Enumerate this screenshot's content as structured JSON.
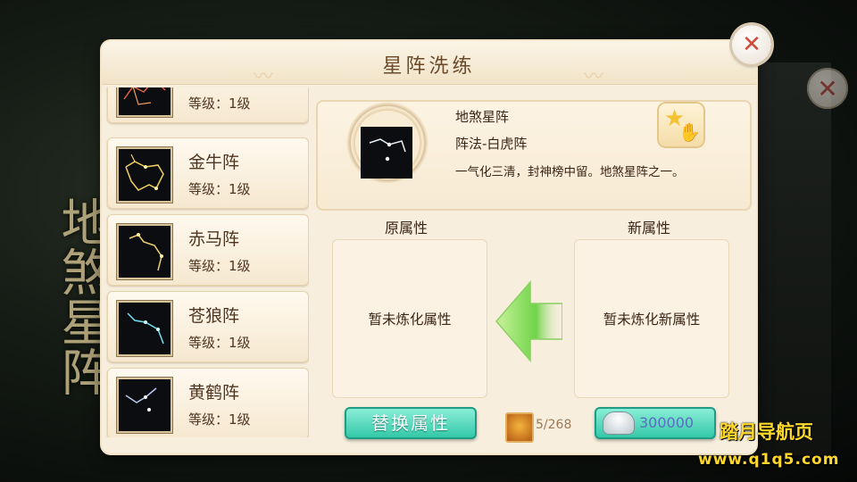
{
  "background": {
    "vertical_title": "地煞星阵"
  },
  "dialog": {
    "title": "星阵洗练",
    "close_icon": "close-x-icon"
  },
  "formation_list": [
    {
      "name": "",
      "level": "等级：1级",
      "icon": "constellation-icon"
    },
    {
      "name": "金牛阵",
      "level": "等级：1级",
      "icon": "golden-ox-constellation-icon"
    },
    {
      "name": "赤马阵",
      "level": "等级：1级",
      "icon": "red-horse-constellation-icon"
    },
    {
      "name": "苍狼阵",
      "level": "等级：1级",
      "icon": "grey-wolf-constellation-icon"
    },
    {
      "name": "黄鹤阵",
      "level": "等级：1级",
      "icon": "yellow-crane-constellation-icon"
    }
  ],
  "detail": {
    "name": "地煞星阵",
    "method": "阵法-白虎阵",
    "description": "一气化三清，封神榜中留。地煞星阵之一。",
    "icon": "white-tiger-constellation-icon"
  },
  "attributes": {
    "original_label": "原属性",
    "new_label": "新属性",
    "original_value": "暂未炼化属性",
    "new_value": "暂未炼化新属性"
  },
  "actions": {
    "replace_label": "替换属性",
    "stone_count": "5/268",
    "silver_cost": "300000"
  },
  "colors": {
    "panel": "#f7eedd",
    "button_teal": "#2fc6a6",
    "arrow_green": "#6fd44a",
    "close_red": "#d24a3a"
  },
  "watermark": {
    "line1": "踏月导航页",
    "line2": "www.q1q5.com"
  }
}
